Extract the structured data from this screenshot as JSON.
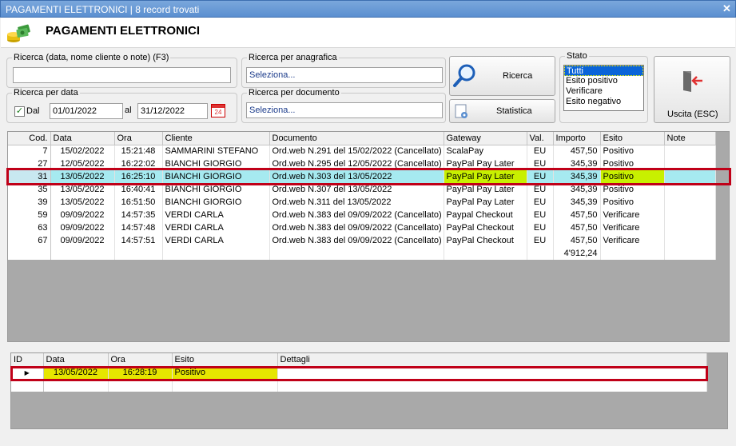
{
  "window": {
    "title": "PAGAMENTI ELETTRONICI | 8 record trovati"
  },
  "header": {
    "title": "PAGAMENTI ELETTRONICI"
  },
  "search": {
    "general_label": "Ricerca (data, nome cliente o note) (F3)",
    "general_value": "",
    "anagrafica_label": "Ricerca per anagrafica",
    "anagrafica_value": "Seleziona...",
    "date_label": "Ricerca per data",
    "date_from_label": "Dal",
    "date_from": "01/01/2022",
    "date_to_label": "al",
    "date_to": "31/12/2022",
    "documento_label": "Ricerca per documento",
    "documento_value": "Seleziona..."
  },
  "buttons": {
    "ricerca": "Ricerca",
    "statistica": "Statistica",
    "uscita": "Uscita (ESC)"
  },
  "stato": {
    "label": "Stato",
    "options": [
      "Tutti",
      "Esito positivo",
      "Verificare",
      "Esito negativo"
    ],
    "selected": "Tutti"
  },
  "main_table": {
    "columns": [
      "Cod.",
      "Data",
      "Ora",
      "Cliente",
      "Documento",
      "Gateway",
      "Val.",
      "Importo",
      "Esito",
      "Note"
    ],
    "rows": [
      [
        "7",
        "15/02/2022",
        "15:21:48",
        "SAMMARINI STEFANO",
        "Ord.web N.291 del 15/02/2022 (Cancellato)",
        "ScalaPay",
        "EU",
        "457,50",
        "Positivo",
        ""
      ],
      [
        "27",
        "12/05/2022",
        "16:22:02",
        "BIANCHI GIORGIO",
        "Ord.web N.295 del 12/05/2022 (Cancellato)",
        "PayPal Pay Later",
        "EU",
        "345,39",
        "Positivo",
        ""
      ],
      [
        "31",
        "13/05/2022",
        "16:25:10",
        "BIANCHI GIORGIO",
        "Ord.web N.303 del 13/05/2022",
        "PayPal Pay Later",
        "EU",
        "345,39",
        "Positivo",
        ""
      ],
      [
        "35",
        "13/05/2022",
        "16:40:41",
        "BIANCHI GIORGIO",
        "Ord.web N.307 del 13/05/2022",
        "PayPal Pay Later",
        "EU",
        "345,39",
        "Positivo",
        ""
      ],
      [
        "39",
        "13/05/2022",
        "16:51:50",
        "BIANCHI GIORGIO",
        "Ord.web N.311 del 13/05/2022",
        "PayPal Pay Later",
        "EU",
        "345,39",
        "Positivo",
        ""
      ],
      [
        "59",
        "09/09/2022",
        "14:57:35",
        "VERDI CARLA",
        "Ord.web N.383 del 09/09/2022 (Cancellato)",
        "Paypal Checkout",
        "EU",
        "457,50",
        "Verificare",
        ""
      ],
      [
        "63",
        "09/09/2022",
        "14:57:48",
        "VERDI CARLA",
        "Ord.web N.383 del 09/09/2022 (Cancellato)",
        "PayPal Checkout",
        "EU",
        "457,50",
        "Verificare",
        ""
      ],
      [
        "67",
        "09/09/2022",
        "14:57:51",
        "VERDI CARLA",
        "Ord.web N.383 del 09/09/2022 (Cancellato)",
        "PayPal Checkout",
        "EU",
        "457,50",
        "Verificare",
        ""
      ]
    ],
    "total": "4'912,24",
    "highlight_color": "#a6eaf0",
    "gateway_highlight": "#c8f000"
  },
  "detail_table": {
    "columns": [
      "ID",
      "Data",
      "Ora",
      "Esito",
      "Dettagli"
    ],
    "rows": [
      [
        "",
        "13/05/2022",
        "16:28:19",
        "Positivo",
        ""
      ]
    ],
    "highlight_color": "#e6e600"
  },
  "accent": {
    "selection_border": "#c00018"
  }
}
